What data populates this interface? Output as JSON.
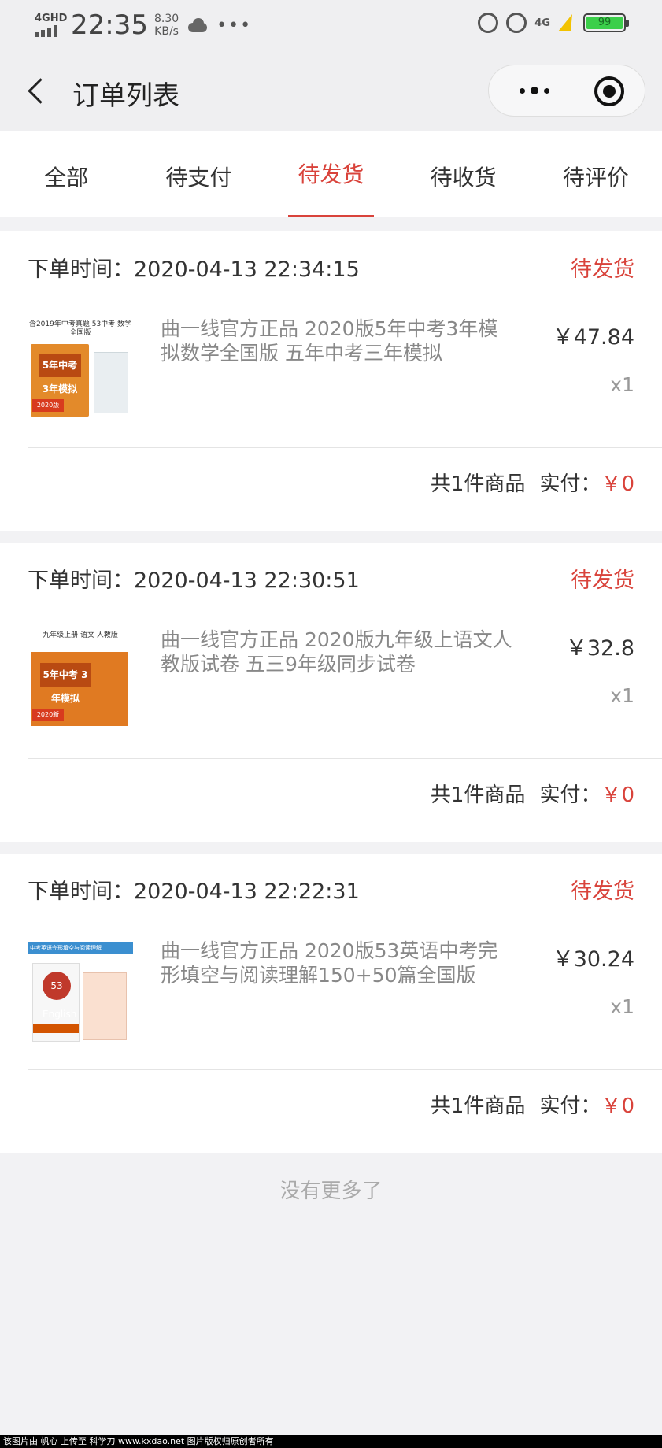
{
  "status_bar": {
    "network": "4GHD",
    "time": "22:35",
    "speed_value": "8.30",
    "speed_unit": "KB/s",
    "more": "•••",
    "right_network": "4G",
    "battery": "99"
  },
  "nav": {
    "title": "订单列表"
  },
  "tabs": [
    {
      "label": "全部",
      "active": false
    },
    {
      "label": "待支付",
      "active": false
    },
    {
      "label": "待发货",
      "active": true
    },
    {
      "label": "待收货",
      "active": false
    },
    {
      "label": "待评价",
      "active": false
    }
  ],
  "orders": [
    {
      "time_label": "下单时间：",
      "time": "2020-04-13 22:34:15",
      "status": "待发货",
      "title": "曲一线官方正品 2020版5年中考3年模拟数学全国版 五年中考三年模拟",
      "price": "￥47.84",
      "qty": "x1",
      "count_text": "共1件商品",
      "paid_label": "实付：",
      "paid_amount": "￥0",
      "thumb_text": "含2019年中考真题 53中考 数学 全国版",
      "thumb_title": "5年中考 3年模拟",
      "thumb_badge": "2020版"
    },
    {
      "time_label": "下单时间：",
      "time": "2020-04-13 22:30:51",
      "status": "待发货",
      "title": "曲一线官方正品 2020版九年级上语文人教版试卷 五三9年级同步试卷",
      "price": "￥32.8",
      "qty": "x1",
      "count_text": "共1件商品",
      "paid_label": "实付：",
      "paid_amount": "￥0",
      "thumb_text": "九年级上册 语文 人教版",
      "thumb_title": "5年中考 3年模拟",
      "thumb_badge": "2020新"
    },
    {
      "time_label": "下单时间：",
      "time": "2020-04-13 22:22:31",
      "status": "待发货",
      "title": "曲一线官方正品 2020版53英语中考完形填空与阅读理解150+50篇全国版",
      "price": "￥30.24",
      "qty": "x1",
      "count_text": "共1件商品",
      "paid_label": "实付：",
      "paid_amount": "￥0",
      "thumb_text": "中考英语完形填空与阅读理解",
      "thumb_title": "53 English",
      "thumb_badge": ""
    }
  ],
  "footer": {
    "no_more": "没有更多了"
  },
  "watermark": "该图片由 帆心 上传至 科学刀 www.kxdao.net 图片版权归原创者所有",
  "colors": {
    "accent": "#d9433b",
    "background": "#f2f2f4"
  }
}
